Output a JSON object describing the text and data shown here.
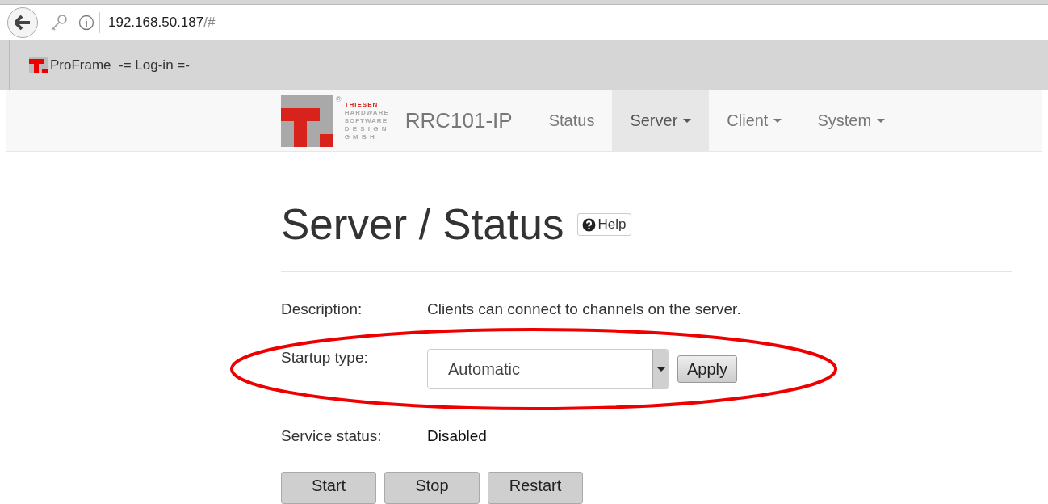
{
  "browser": {
    "url_host": "192.168.50.187",
    "url_rest": "/#"
  },
  "bookmarks": [
    {
      "label": "ProFrame  -= Log-in =-"
    }
  ],
  "navbar": {
    "logo": {
      "mark": "®",
      "lines": [
        "THIESEN",
        "HARDWARE",
        "SOFTWARE",
        "D E S I G N",
        "G  M  B  H"
      ]
    },
    "brand": "RRC101-IP",
    "items": [
      {
        "label": "Status",
        "dropdown": false,
        "selected": false
      },
      {
        "label": "Server",
        "dropdown": true,
        "selected": true
      },
      {
        "label": "Client",
        "dropdown": true,
        "selected": false
      },
      {
        "label": "System",
        "dropdown": true,
        "selected": false
      }
    ]
  },
  "page": {
    "title": "Server / Status",
    "help": "Help",
    "description": {
      "label": "Description:",
      "value": "Clients can connect to channels on the server."
    },
    "startup": {
      "label": "Startup type:",
      "value": "Automatic",
      "apply": "Apply",
      "highlighted": true
    },
    "service": {
      "label": "Service status:",
      "value": "Disabled"
    },
    "buttons": [
      "Start",
      "Stop",
      "Restart"
    ]
  }
}
